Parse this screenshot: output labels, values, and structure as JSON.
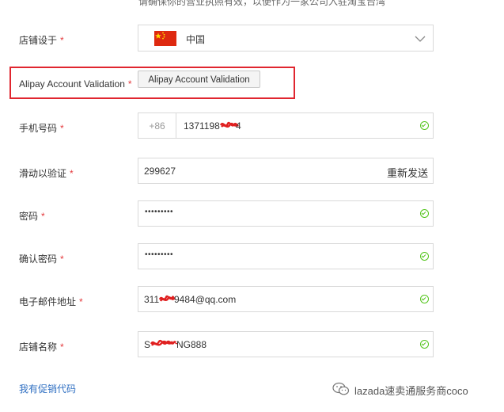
{
  "form": {
    "top_note": "请确保你的营业执照有效，以便作为一家公司入驻淘宝台湾",
    "required_mark": "*",
    "store_location": {
      "label": "店铺设于",
      "value": "中国",
      "flag_icon": "china-flag-icon"
    },
    "alipay": {
      "label": "Alipay Account Validation",
      "button_label": "Alipay Account Validation"
    },
    "phone": {
      "label": "手机号码",
      "prefix": "+86",
      "value": "1371198"
    },
    "captcha": {
      "label": "滑动以验证",
      "value": "299627",
      "resend_label": "重新发送"
    },
    "password": {
      "label": "密码",
      "masked": "•••••••••"
    },
    "confirm_password": {
      "label": "确认密码",
      "masked": "•••••••••"
    },
    "email": {
      "label": "电子邮件地址",
      "value": "311",
      "value_tail": "9484@qq.com"
    },
    "store_name": {
      "label": "店铺名称",
      "value_head": "S",
      "value_tail": "NG888"
    },
    "promo_link": "我有促销代码"
  },
  "watermark": {
    "text": "lazada速卖通服务商coco",
    "icon": "wechat-icon"
  },
  "colors": {
    "required": "#e4393c",
    "valid_check": "#52c41a",
    "highlight_box": "#e0262f",
    "link": "#2f6fc2"
  }
}
